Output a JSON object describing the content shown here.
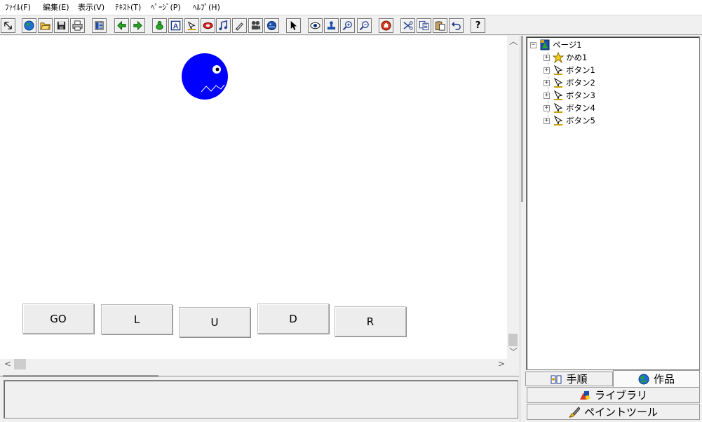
{
  "menubar": {
    "items": [
      "ﾌｧｲﾙ(F)",
      "編集(E)",
      "表示(V)",
      "ﾃｷｽﾄ(T)",
      "ﾍﾟｰｼﾞ(P)",
      "ﾍﾙﾌﾟ(H)"
    ]
  },
  "toolbar": {
    "buttons": [
      "select-mode-icon",
      "globe-icon",
      "open-folder-icon",
      "save-icon",
      "print-icon",
      "layout-icon",
      "back-arrow-icon",
      "forward-arrow-icon",
      "character-icon",
      "text-tool-icon",
      "button-tool-icon",
      "shape-tool-icon",
      "music-icon",
      "pen-tool-icon",
      "movie-icon",
      "sound-icon",
      "pointer-icon",
      "view-icon",
      "stamp-icon",
      "zoom-in-icon",
      "zoom-out-icon",
      "stop-icon",
      "cut-icon",
      "copy-icon",
      "paste-icon",
      "undo-icon",
      "help-icon"
    ],
    "help_label": "?",
    "text_tool_label": "A"
  },
  "canvas": {
    "background": "#ffffff",
    "character_color": "#0000ff",
    "buttons": [
      {
        "label": "GO"
      },
      {
        "label": "L"
      },
      {
        "label": "U"
      },
      {
        "label": "D"
      },
      {
        "label": "R"
      }
    ]
  },
  "scroll": {
    "up": "︿",
    "down": "﹀",
    "left": "<",
    "right": ">"
  },
  "tree": {
    "root": {
      "label": "ページ1",
      "expander": "−",
      "icon": "page-icon"
    },
    "children": [
      {
        "label": "かめ1",
        "icon": "turtle-icon",
        "expander": "+"
      },
      {
        "label": "ボタン1",
        "icon": "button-object-icon",
        "expander": "+"
      },
      {
        "label": "ボタン2",
        "icon": "button-object-icon",
        "expander": "+"
      },
      {
        "label": "ボタン3",
        "icon": "button-object-icon",
        "expander": "+"
      },
      {
        "label": "ボタン4",
        "icon": "button-object-icon",
        "expander": "+"
      },
      {
        "label": "ボタン5",
        "icon": "button-object-icon",
        "expander": "+"
      }
    ]
  },
  "tabs": {
    "procedure": "手順",
    "works": "作品",
    "library": "ライブラリ",
    "paint_tool": "ペイントツール",
    "active": "works"
  },
  "colors": {
    "accent_blue": "#0000ff",
    "toolbar_green": "#2aa52a",
    "stop_red": "#d4391f"
  }
}
